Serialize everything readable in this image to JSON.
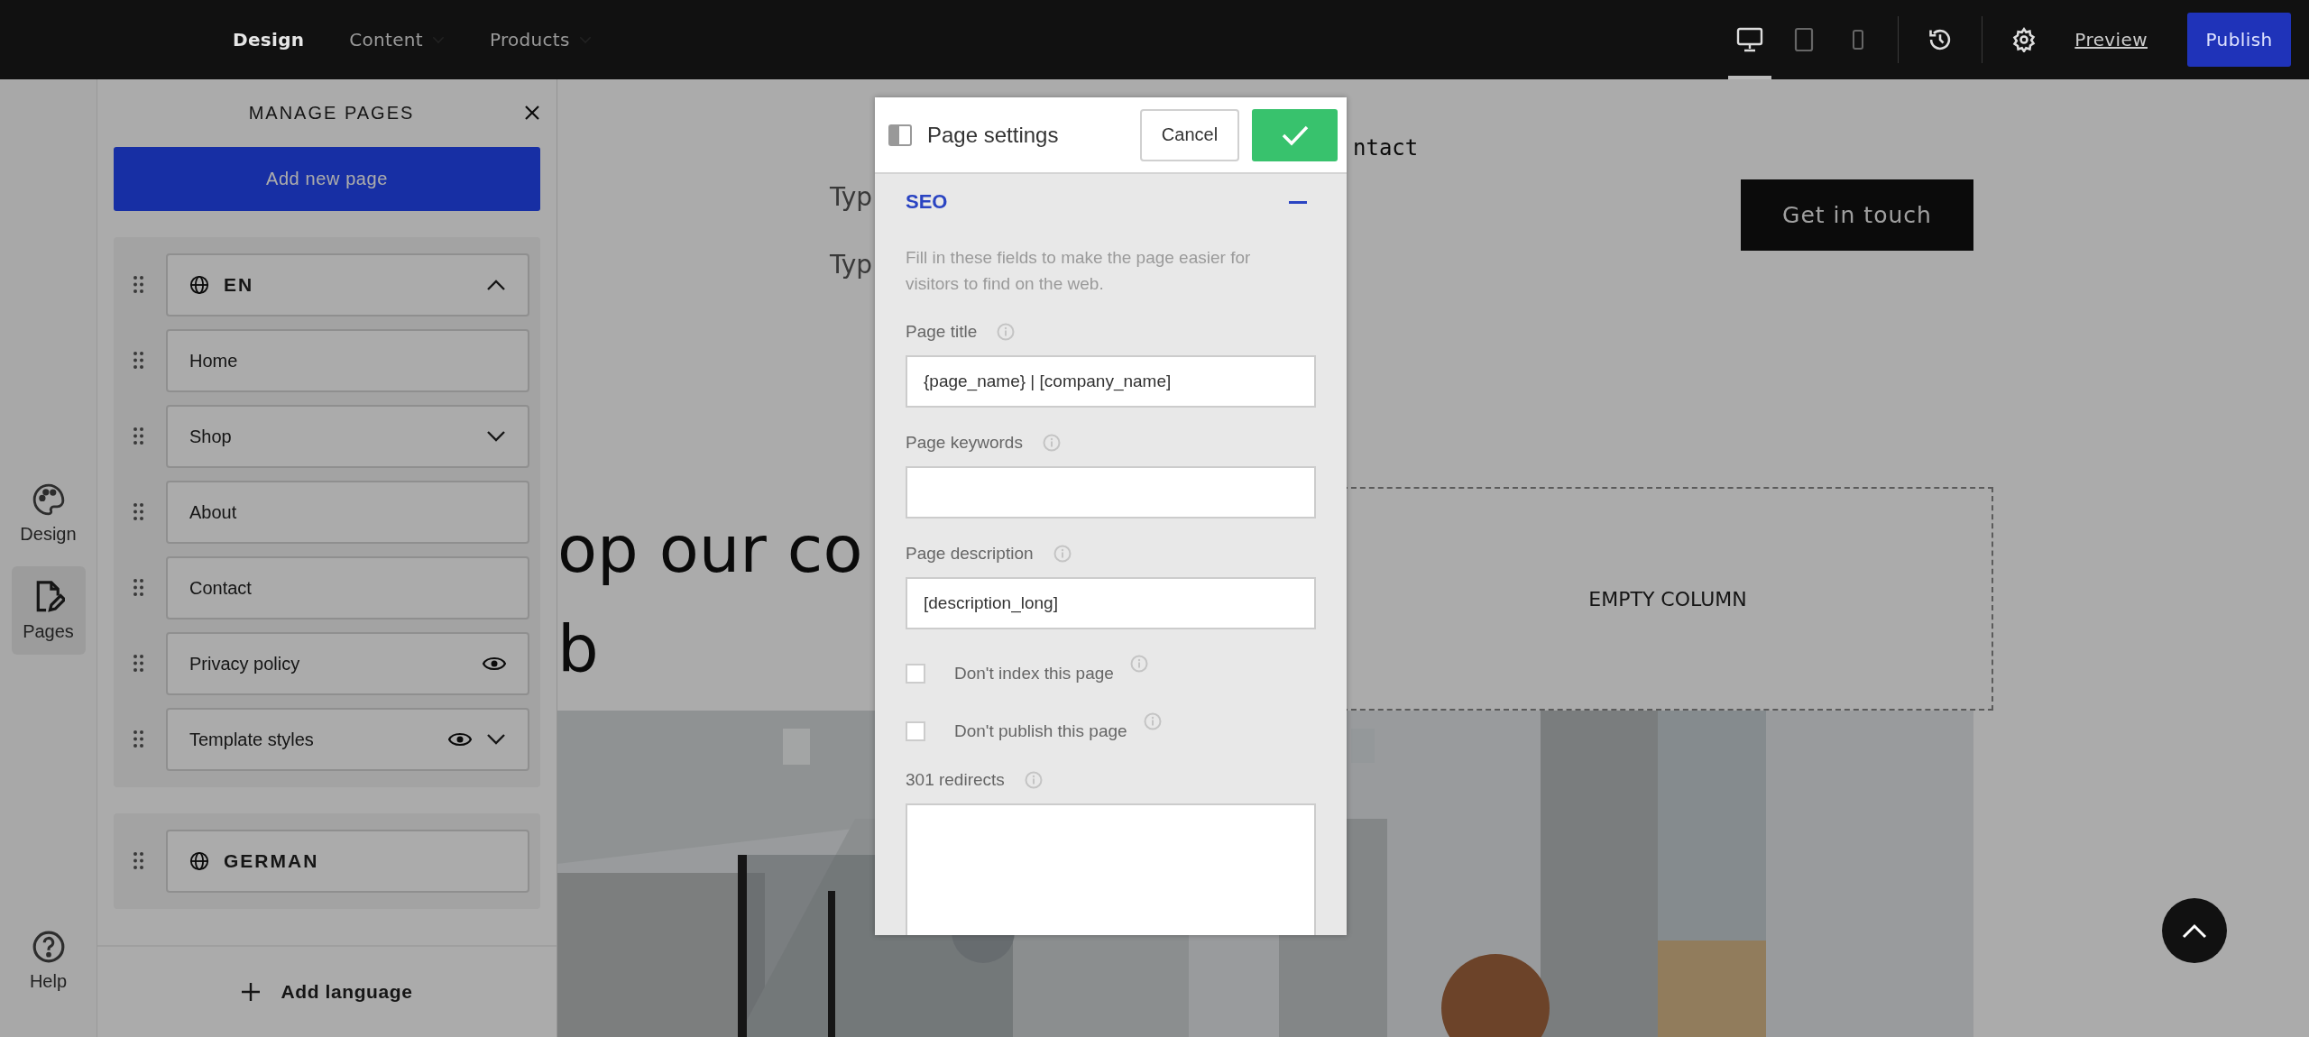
{
  "topbar": {
    "nav": [
      {
        "label": "Design",
        "selected": true,
        "dropdown": false
      },
      {
        "label": "Content",
        "selected": false,
        "dropdown": true
      },
      {
        "label": "Products",
        "selected": false,
        "dropdown": true
      }
    ],
    "devices": [
      {
        "kind": "desktop",
        "selected": true
      },
      {
        "kind": "tablet",
        "selected": false
      },
      {
        "kind": "mobile",
        "selected": false
      }
    ],
    "preview": "Preview",
    "publish": "Publish"
  },
  "rail": {
    "items": [
      {
        "kind": "design",
        "label": "Design",
        "selected": false
      },
      {
        "kind": "pages",
        "label": "Pages",
        "selected": true
      }
    ],
    "help": "Help"
  },
  "panel": {
    "title": "MANAGE PAGES",
    "add_button": "Add new page",
    "languages": [
      {
        "label": "EN",
        "expanded": true,
        "pages": [
          {
            "label": "Home",
            "hidden": false
          },
          {
            "label": "Shop",
            "hidden": false,
            "expanded": false
          },
          {
            "label": "About",
            "hidden": false
          },
          {
            "label": "Contact",
            "hidden": false
          },
          {
            "label": "Privacy policy",
            "hidden": true
          },
          {
            "label": "Template styles",
            "hidden": true,
            "expanded": false
          }
        ]
      },
      {
        "label": "GERMAN"
      }
    ],
    "add_language": "Add language"
  },
  "site": {
    "nav_fragment": "ntact",
    "lines": [
      "Typ",
      "Typ"
    ],
    "cta": "Get in touch",
    "heading": [
      "op our co",
      "b"
    ],
    "empty_column": "EMPTY COLUMN",
    "photo": {
      "kind": "picture"
    }
  },
  "modal": {
    "title": "Page settings",
    "cancel": "Cancel",
    "section": {
      "title": "SEO",
      "expanded": true,
      "intro": "Fill in these fields to make the page easier for visitors to find on the web.",
      "fields": [
        {
          "label": "Page title",
          "value": "{page_name} | [company_name]"
        },
        {
          "label": "Page keywords"
        },
        {
          "label": "Page description",
          "value": "[description_long]"
        }
      ],
      "checkboxes": [
        {
          "label": "Don't index this page",
          "checked": false
        },
        {
          "label": "Don't publish this page",
          "checked": false
        }
      ],
      "redirects": {
        "label": "301 redirects"
      }
    }
  }
}
